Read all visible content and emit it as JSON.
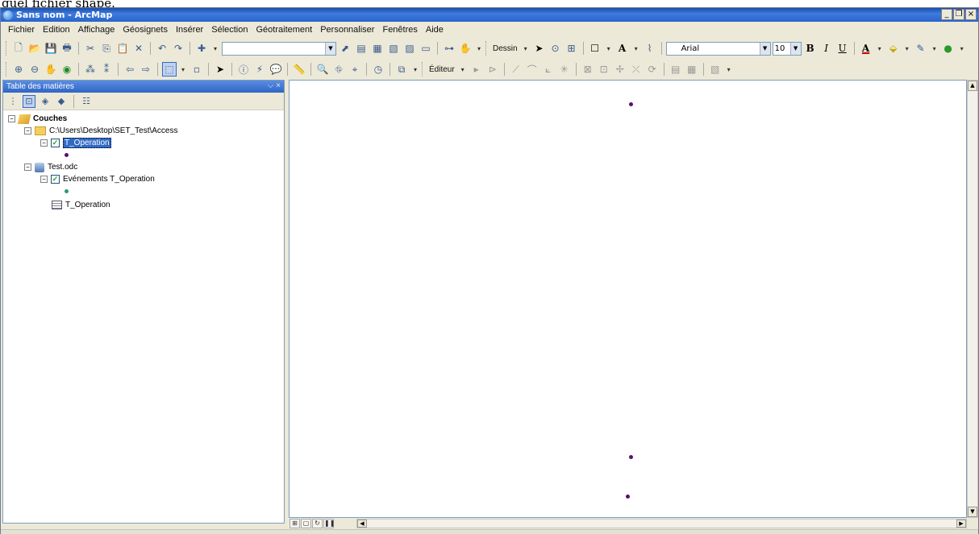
{
  "caption_above": "quel fichier shape.",
  "window": {
    "title": "Sans nom - ArcMap"
  },
  "menu": [
    "Fichier",
    "Edition",
    "Affichage",
    "Géosignets",
    "Insérer",
    "Sélection",
    "Géotraitement",
    "Personnaliser",
    "Fenêtres",
    "Aide"
  ],
  "toolbar": {
    "draw_label": "Dessin",
    "font_name": "Arial",
    "font_size": "10",
    "bold": "B",
    "italic": "I",
    "underline": "U",
    "text_a": "A",
    "editor_label": "Éditeur"
  },
  "toc": {
    "title": "Table des matières",
    "pin_close": "⌵ ×",
    "items": [
      {
        "label": "Couches"
      },
      {
        "label": "C:\\Users\\Desktop\\SET_Test\\Access"
      },
      {
        "label": "T_Operation"
      },
      {
        "label": "Test.odc"
      },
      {
        "label": "Evénements T_Operation"
      },
      {
        "label": "T_Operation"
      }
    ]
  },
  "map": {
    "point_color": "#5a0f6b",
    "event_symbol_color": "#2a9a7a",
    "point_count": 3
  },
  "colors": {
    "titlebar": "#245edb",
    "selection": "#316ac5"
  }
}
